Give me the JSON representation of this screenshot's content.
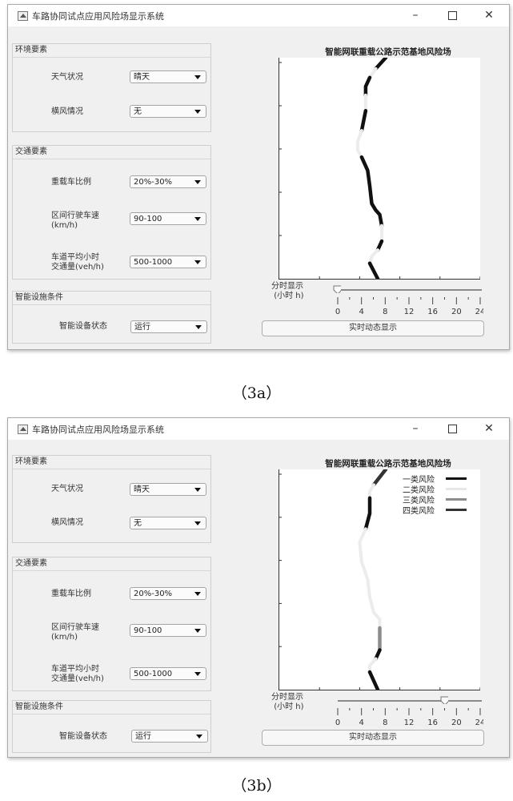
{
  "windows": [
    {
      "id": "3a",
      "title": "车路协同试点应用风险场显示系统",
      "controls": {
        "minimize": "–",
        "maximize": "□",
        "close": "✕"
      },
      "panels": [
        {
          "title": "环境要素",
          "fields": [
            {
              "label": "天气状况",
              "value": "晴天"
            },
            {
              "label": "横风情况",
              "value": "无"
            }
          ]
        },
        {
          "title": "交通要素",
          "fields": [
            {
              "label": "重载车比例",
              "value": "20%-30%"
            },
            {
              "label": "区间行驶车速\n(km/h)",
              "label_line1": "区间行驶车速",
              "label_line2": "(km/h)",
              "value": "90-100"
            },
            {
              "label": "车道平均小时交通量(veh/h)",
              "label_line1": "车道平均小时",
              "label_line2": "交通量(veh/h)",
              "value": "500-1000"
            }
          ]
        },
        {
          "title": "智能设施条件",
          "fields": [
            {
              "label": "智能设备状态",
              "value": "运行"
            }
          ]
        }
      ],
      "plot_title": "智能网联重载公路示范基地风险场",
      "slider_label_line1": "分时显示",
      "slider_label_line2": "(小时 h)",
      "slider_value_hours": 0,
      "realtime_button": "实时动态显示",
      "caption": "（3a）"
    },
    {
      "id": "3b",
      "title": "车路协同试点应用风险场显示系统",
      "controls": {
        "minimize": "–",
        "maximize": "□",
        "close": "✕"
      },
      "panels": [
        {
          "title": "环境要素",
          "fields": [
            {
              "label": "天气状况",
              "value": "晴天"
            },
            {
              "label": "横风情况",
              "value": "无"
            }
          ]
        },
        {
          "title": "交通要素",
          "fields": [
            {
              "label": "重载车比例",
              "value": "20%-30%"
            },
            {
              "label": "区间行驶车速\n(km/h)",
              "label_line1": "区间行驶车速",
              "label_line2": "(km/h)",
              "value": "90-100"
            },
            {
              "label": "车道平均小时交通量(veh/h)",
              "label_line1": "车道平均小时",
              "label_line2": "交通量(veh/h)",
              "value": "500-1000"
            }
          ]
        },
        {
          "title": "智能设施条件",
          "fields": [
            {
              "label": "智能设备状态",
              "value": "运行"
            }
          ]
        }
      ],
      "plot_title": "智能网联重载公路示范基地风险场",
      "legend": [
        {
          "label": "一类风险",
          "color": "#111111"
        },
        {
          "label": "二类风险",
          "color": "#e8e8e8"
        },
        {
          "label": "三类风险",
          "color": "#8c8c8c"
        },
        {
          "label": "四类风险",
          "color": "#333333"
        }
      ],
      "slider_label_line1": "分时显示",
      "slider_label_line2": "(小时 h)",
      "slider_value_hours": 18,
      "realtime_button": "实时动态显示",
      "caption": "（3b）"
    }
  ],
  "slider_ticks": [
    "0",
    "4",
    "8",
    "12",
    "16",
    "20",
    "24"
  ],
  "slider_range": [
    0,
    24
  ],
  "chart_data": [
    {
      "type": "line",
      "title": "智能网联重载公路示范基地风险场",
      "note": "Road centerline risk segments, top to bottom; x in relative lane offset units (0-1), y in relative road length (0 = top, 1 = bottom)",
      "segments": [
        {
          "risk": "一类风险",
          "points": [
            [
              0.53,
              0.0
            ],
            [
              0.48,
              0.05
            ]
          ]
        },
        {
          "risk": "二类风险",
          "points": [
            [
              0.48,
              0.05
            ],
            [
              0.45,
              0.09
            ]
          ]
        },
        {
          "risk": "一类风险",
          "points": [
            [
              0.45,
              0.09
            ],
            [
              0.43,
              0.13
            ],
            [
              0.43,
              0.17
            ]
          ]
        },
        {
          "risk": "二类风险",
          "points": [
            [
              0.43,
              0.17
            ],
            [
              0.43,
              0.24
            ]
          ]
        },
        {
          "risk": "一类风险",
          "points": [
            [
              0.43,
              0.24
            ],
            [
              0.41,
              0.33
            ]
          ]
        },
        {
          "risk": "二类风险",
          "points": [
            [
              0.41,
              0.33
            ],
            [
              0.39,
              0.38
            ],
            [
              0.39,
              0.42
            ],
            [
              0.41,
              0.45
            ]
          ]
        },
        {
          "risk": "一类风险",
          "points": [
            [
              0.41,
              0.45
            ],
            [
              0.44,
              0.51
            ],
            [
              0.45,
              0.58
            ],
            [
              0.46,
              0.66
            ],
            [
              0.48,
              0.69
            ],
            [
              0.5,
              0.71
            ],
            [
              0.51,
              0.76
            ]
          ]
        },
        {
          "risk": "二类风险",
          "points": [
            [
              0.51,
              0.76
            ],
            [
              0.51,
              0.83
            ]
          ]
        },
        {
          "risk": "一类风险",
          "points": [
            [
              0.51,
              0.83
            ],
            [
              0.49,
              0.87
            ]
          ]
        },
        {
          "risk": "二类风险",
          "points": [
            [
              0.49,
              0.87
            ],
            [
              0.46,
              0.9
            ],
            [
              0.45,
              0.93
            ]
          ]
        },
        {
          "risk": "一类风险",
          "points": [
            [
              0.45,
              0.93
            ],
            [
              0.49,
              1.0
            ]
          ]
        }
      ],
      "x_ticks": 5,
      "y_ticks": 5
    },
    {
      "type": "line",
      "title": "智能网联重载公路示范基地风险场",
      "legend": [
        "一类风险",
        "二类风险",
        "三类风险",
        "四类风险"
      ],
      "legend_position": "top-right",
      "segments": [
        {
          "risk": "四类风险",
          "points": [
            [
              0.53,
              0.0
            ],
            [
              0.47,
              0.07
            ]
          ]
        },
        {
          "risk": "二类风险",
          "points": [
            [
              0.47,
              0.07
            ],
            [
              0.45,
              0.1
            ],
            [
              0.45,
              0.13
            ]
          ]
        },
        {
          "risk": "一类风险",
          "points": [
            [
              0.45,
              0.13
            ],
            [
              0.45,
              0.2
            ],
            [
              0.43,
              0.27
            ]
          ]
        },
        {
          "risk": "二类风险",
          "points": [
            [
              0.43,
              0.27
            ],
            [
              0.4,
              0.33
            ],
            [
              0.41,
              0.42
            ],
            [
              0.44,
              0.5
            ],
            [
              0.45,
              0.58
            ],
            [
              0.47,
              0.65
            ],
            [
              0.5,
              0.68
            ],
            [
              0.5,
              0.72
            ]
          ]
        },
        {
          "risk": "三类风险",
          "points": [
            [
              0.5,
              0.72
            ],
            [
              0.5,
              0.82
            ]
          ]
        },
        {
          "risk": "一类风险",
          "points": [
            [
              0.5,
              0.82
            ],
            [
              0.48,
              0.86
            ]
          ]
        },
        {
          "risk": "二类风险",
          "points": [
            [
              0.48,
              0.86
            ],
            [
              0.45,
              0.89
            ],
            [
              0.45,
              0.92
            ]
          ]
        },
        {
          "risk": "一类风险",
          "points": [
            [
              0.45,
              0.92
            ],
            [
              0.49,
              1.0
            ]
          ]
        }
      ],
      "x_ticks": 5,
      "y_ticks": 5
    }
  ]
}
